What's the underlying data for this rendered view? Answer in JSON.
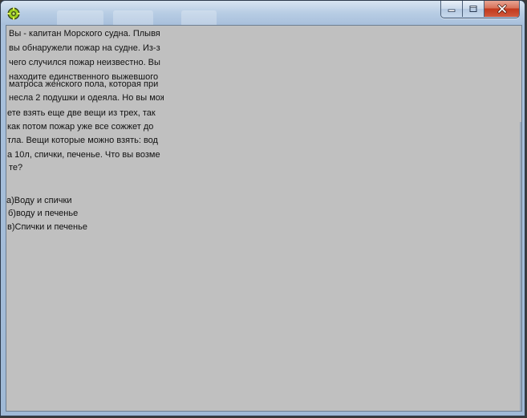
{
  "window": {
    "title": "",
    "controls": {
      "minimize": "minimize",
      "maximize": "maximize",
      "close": "close"
    }
  },
  "question": {
    "lines": [
      "Вы - капитан Морского судна. Плывя",
      "вы обнаружели пожар на судне. Из-з",
      "чего случился пожар неизвестно. Вы",
      "находите единственного выжевшого",
      "матроса женского пола, которая при",
      "несла 2 подушки и одеяла. Но вы мож",
      "ете взять еще две вещи из трех, так",
      "как потом пожар уже все сожжет до",
      "тла. Вещи которые можно взять: вод",
      "а 10л, спички, печенье. Что вы возме",
      "те?"
    ]
  },
  "answers": {
    "a": "а)Воду и спички",
    "b": "б)воду и печенье",
    "c": "в)Спички и печенье"
  },
  "colors": {
    "client_bg": "#c0c0c0",
    "close_button": "#c2391c",
    "frame": "#a9c1dc"
  },
  "icons": [
    "app-gear-icon",
    "minimize-icon",
    "maximize-icon",
    "close-icon"
  ]
}
